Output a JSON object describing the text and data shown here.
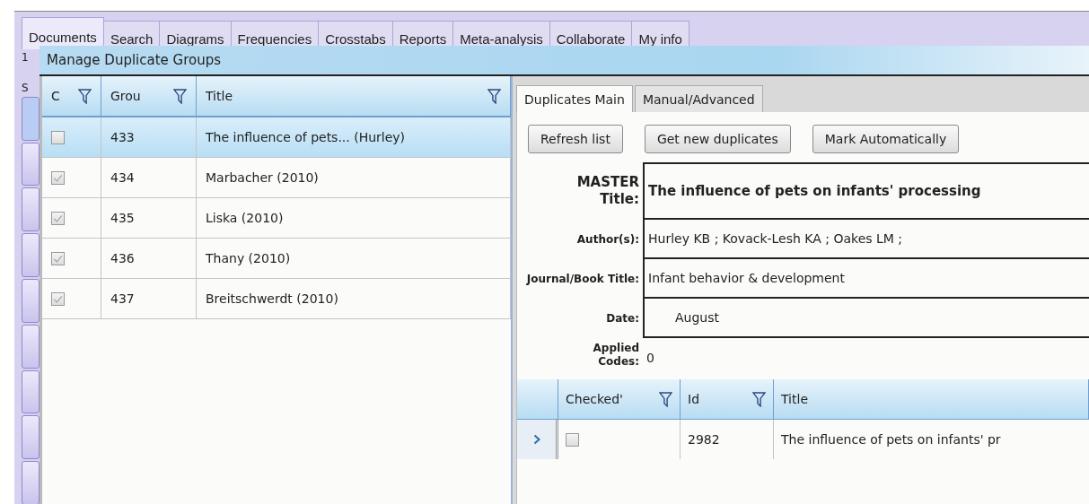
{
  "main_tabs": [
    {
      "label": "Documents",
      "selected": true
    },
    {
      "label": "Search",
      "selected": false
    },
    {
      "label": "Diagrams",
      "selected": false
    },
    {
      "label": "Frequencies",
      "selected": false
    },
    {
      "label": "Crosstabs",
      "selected": false
    },
    {
      "label": "Reports",
      "selected": false
    },
    {
      "label": "Meta-analysis",
      "selected": false
    },
    {
      "label": "Collaborate",
      "selected": false
    },
    {
      "label": "My info",
      "selected": false
    }
  ],
  "background_texts": [
    "1",
    "S"
  ],
  "dialog": {
    "title": "Manage Duplicate Groups",
    "groups_table": {
      "columns": [
        "C",
        "Grou",
        "Title"
      ],
      "rows": [
        {
          "checked": false,
          "group": "433",
          "title": "The influence of pets... (Hurley)",
          "selected": true
        },
        {
          "checked": true,
          "group": "434",
          "title": "Marbacher (2010)",
          "selected": false
        },
        {
          "checked": true,
          "group": "435",
          "title": "Liska (2010)",
          "selected": false
        },
        {
          "checked": true,
          "group": "436",
          "title": "Thany (2010)",
          "selected": false
        },
        {
          "checked": true,
          "group": "437",
          "title": "Breitschwerdt (2010)",
          "selected": false
        }
      ]
    },
    "tabs": [
      {
        "label": "Duplicates Main",
        "selected": true
      },
      {
        "label": "Manual/Advanced",
        "selected": false
      }
    ],
    "buttons": [
      "Refresh list",
      "Get new duplicates",
      "Mark Automatically"
    ],
    "details": [
      {
        "kind": "title",
        "label": "MASTER Title:",
        "value": "The influence of pets on infants' processing"
      },
      {
        "kind": "field",
        "label": "Author(s):",
        "value": "Hurley KB ; Kovack-Lesh KA ; Oakes LM ;"
      },
      {
        "kind": "field",
        "label": "Journal/Book Title:",
        "value": "Infant behavior & development"
      },
      {
        "kind": "date",
        "label": "Date:",
        "value": "August"
      },
      {
        "kind": "plain",
        "label": "Applied Codes:",
        "value": "0"
      }
    ],
    "items_table": {
      "columns": [
        "Checked'",
        "Id",
        "Title"
      ],
      "rows": [
        {
          "current": true,
          "checked": false,
          "id": "2982",
          "title": "The influence of pets on infants' pr"
        }
      ]
    }
  }
}
